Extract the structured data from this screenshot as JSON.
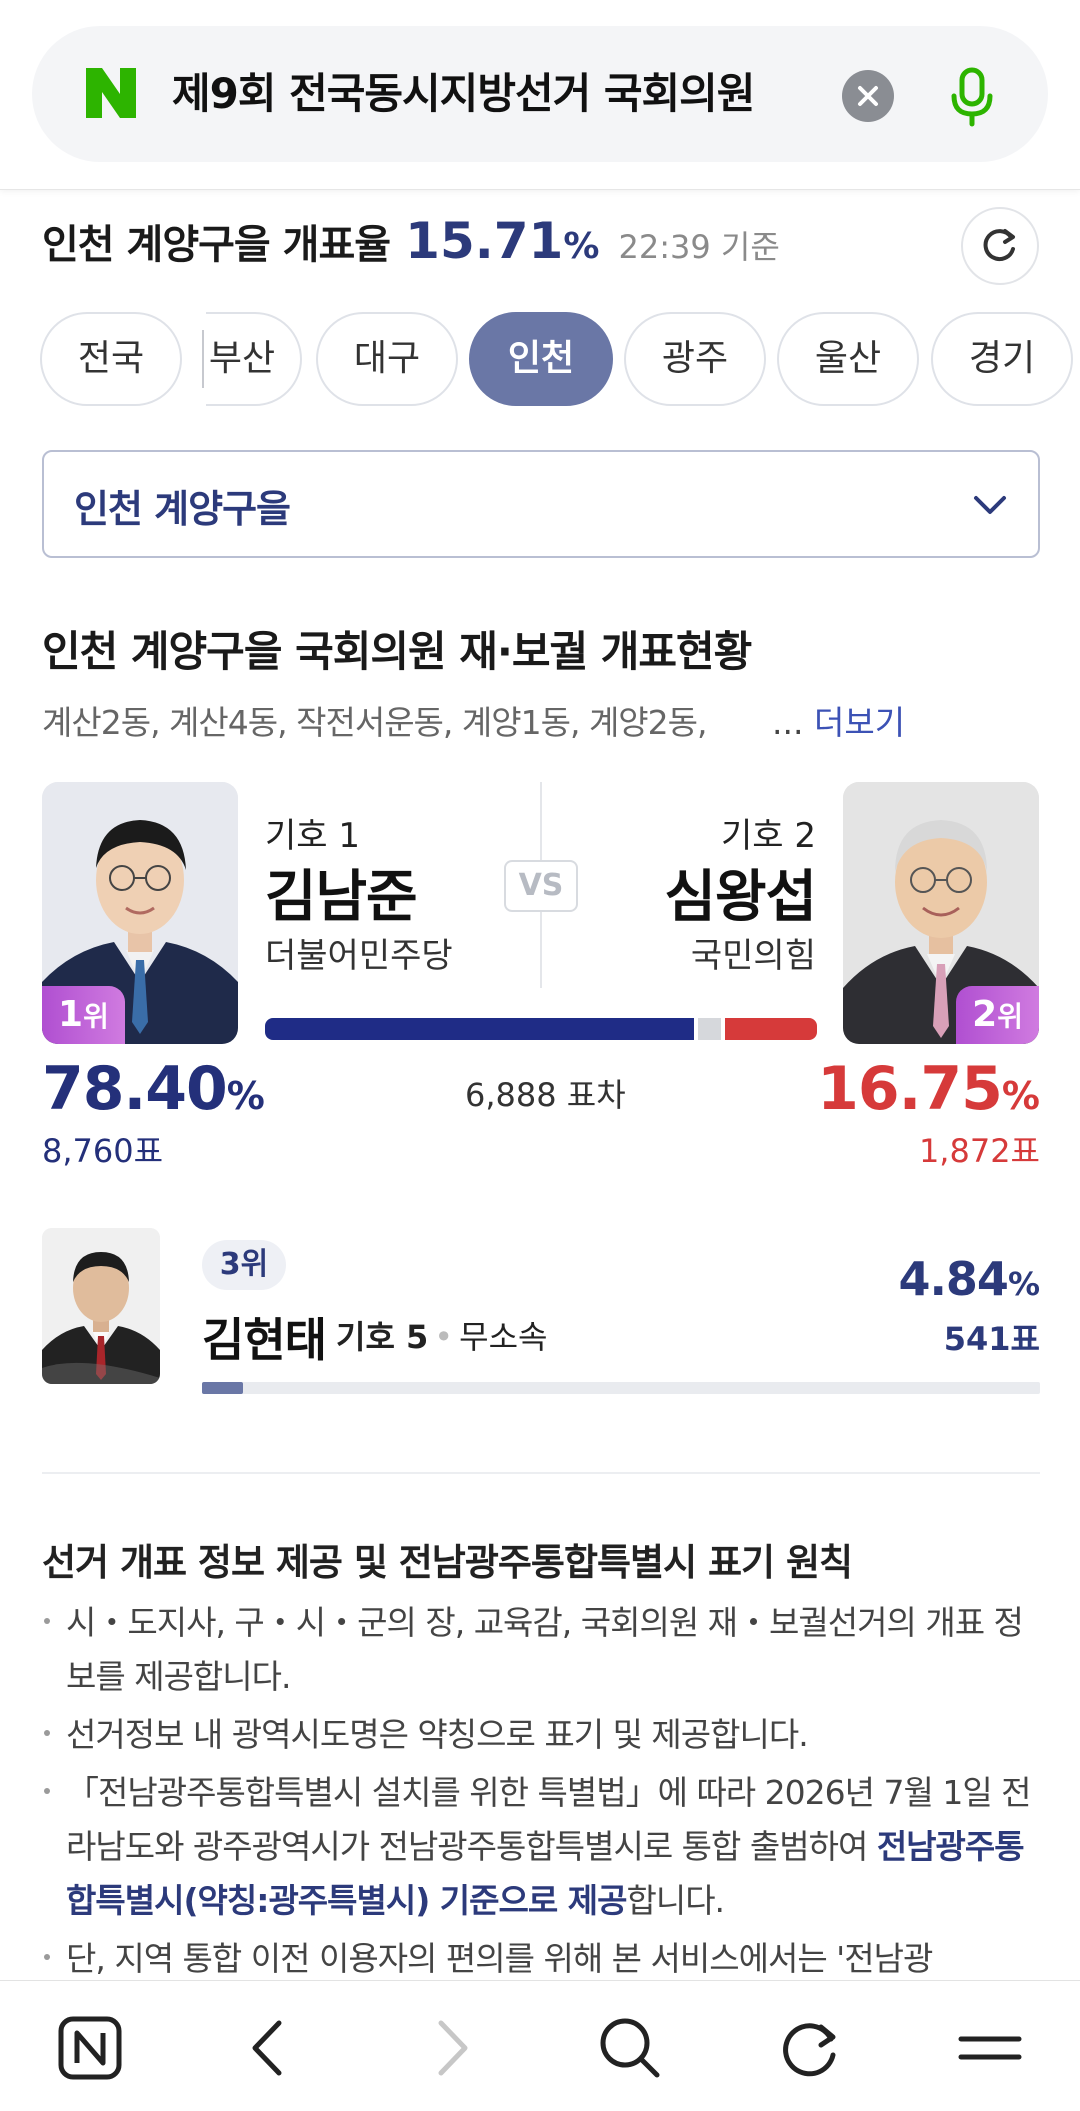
{
  "search": {
    "query": "제9회 전국동시지방선거 국회의원",
    "icons": {
      "logo": "naver-logo-icon",
      "clear": "close-icon",
      "mic": "microphone-icon"
    }
  },
  "header": {
    "title": "인천 계양구을 개표율",
    "rate": "15.71",
    "rate_unit": "%",
    "time": "22:39 기준",
    "refresh_icon": "refresh-icon"
  },
  "regions": [
    "전국",
    "부산",
    "대구",
    "인천",
    "광주",
    "울산",
    "경기"
  ],
  "active_region": "인천",
  "district_select": {
    "value": "인천 계양구을"
  },
  "section": {
    "title": "인천 계양구을 국회의원 재·보궐 개표현황",
    "areas": "계산2동, 계산4동, 작전서운동, 계양1동, 계양2동,",
    "more_dots": "...",
    "more_label": "더보기"
  },
  "vs_label": "VS",
  "candidates": [
    {
      "rank": "1",
      "rank_unit": "위",
      "number": "기호 1",
      "name": "김남준",
      "party": "더불어민주당",
      "percent": "78.40",
      "percent_unit": "%",
      "votes": "8,760표",
      "share": 78.4,
      "color": "#1f2c86"
    },
    {
      "rank": "2",
      "rank_unit": "위",
      "number": "기호 2",
      "name": "심왕섭",
      "party": "국민의힘",
      "percent": "16.75",
      "percent_unit": "%",
      "votes": "1,872표",
      "share": 16.75,
      "color": "#d63a3a"
    }
  ],
  "other_share_color": "#d6d8dc",
  "vote_gap": "6,888 표차",
  "third_candidate": {
    "rank": "3위",
    "name": "김현태",
    "number": "기호 5",
    "party": "무소속",
    "percent": "4.84",
    "percent_unit": "%",
    "votes": "541표",
    "share": 4.84
  },
  "notice": {
    "title": "선거 개표 정보 제공 및 전남광주통합특별시 표기 원칙",
    "items": [
      "시・도지사, 구・시・군의 장, 교육감, 국회의원 재・보궐선거의 개표 정보를 제공합니다.",
      "선거정보 내 광역시도명은 약칭으로 표기 및 제공합니다.",
      "「전남광주통합특별시 설치를 위한 특별법」에 따라 2026년 7월 1일 전라남도와 광주광역시가 전남광주통합특별시로 통합 출범하여 ",
      "단, 지역 통합 이전 이용자의 편의를 위해 본 서비스에서는 '전남광"
    ],
    "item3_highlight": "전남광주통합특별시(약칭:광주특별시) 기준으로 제공",
    "item3_tail": "합니다."
  },
  "bottom_nav": [
    "naver-home-icon",
    "back-icon",
    "forward-icon",
    "search-icon",
    "reload-icon",
    "menu-icon"
  ]
}
